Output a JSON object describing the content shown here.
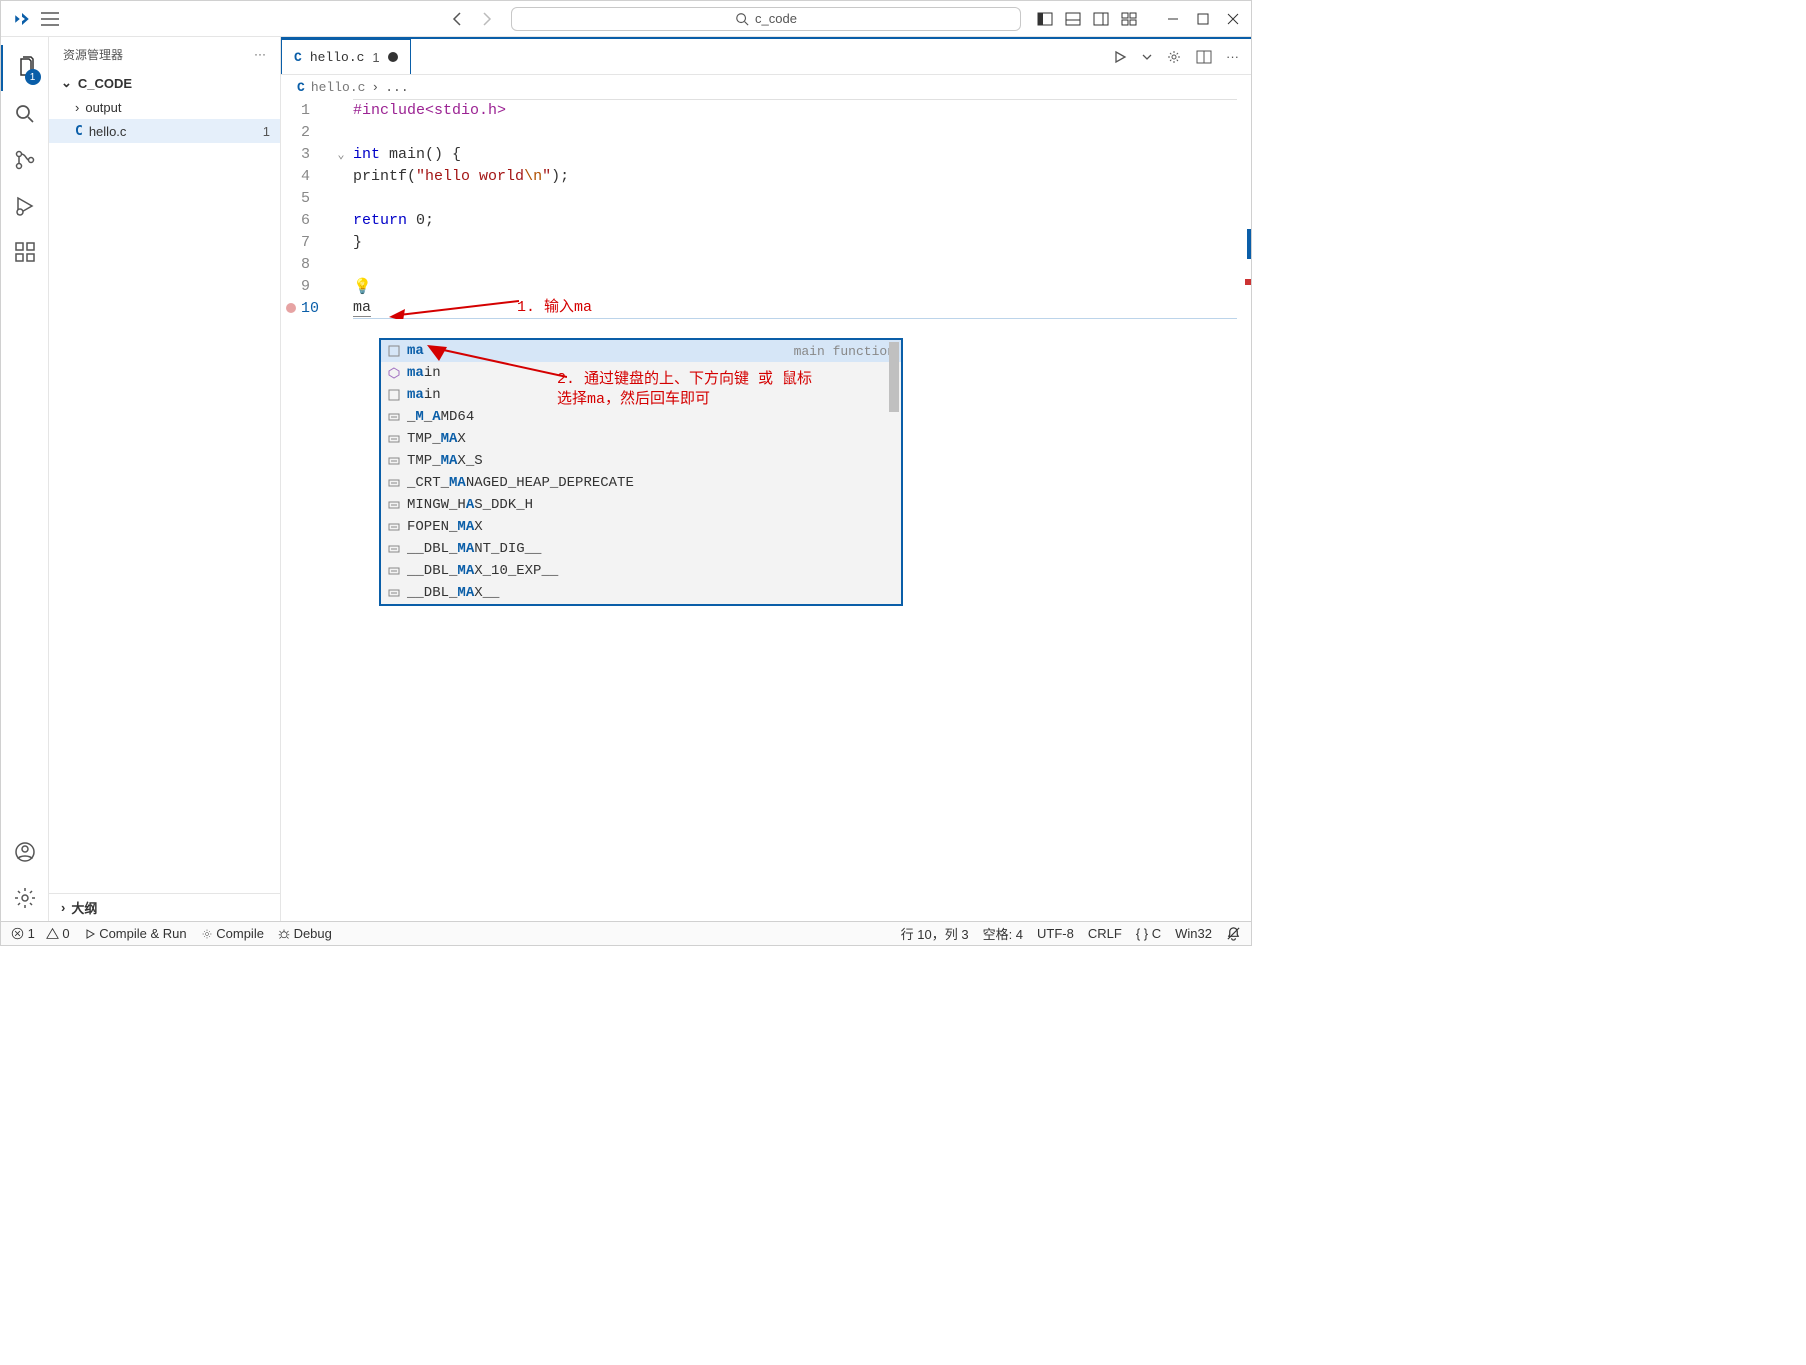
{
  "title_bar": {
    "search_text": "c_code"
  },
  "activity_bar": {
    "explorer_badge": "1"
  },
  "sidebar": {
    "title": "资源管理器",
    "project": "C_CODE",
    "items": [
      {
        "label": "output",
        "type": "folder"
      },
      {
        "label": "hello.c",
        "type": "c",
        "count": "1"
      }
    ],
    "outline_label": "大纲"
  },
  "tabs": {
    "active": {
      "label": "hello.c",
      "count": "1"
    }
  },
  "breadcrumb": {
    "file": "hello.c",
    "rest": "..."
  },
  "editor": {
    "lines": [
      "1",
      "2",
      "3",
      "4",
      "5",
      "6",
      "7",
      "8",
      "9",
      "10"
    ],
    "code": {
      "l1_pre1": "#include",
      "l1_pre2": "<stdio.h>",
      "l3_kw": "int",
      "l3_rest": " main() {",
      "l4_call": "printf",
      "l4_open": "(",
      "l4_str1": "\"hello world",
      "l4_esc": "\\n",
      "l4_str2": "\"",
      "l4_close": ");",
      "l6_kw": "return",
      "l6_rest": " 0;",
      "l7": "}",
      "l10_typed": "ma"
    }
  },
  "suggest": {
    "detail": "main function",
    "items": [
      {
        "icon": "snippet",
        "parts": [
          "ma"
        ],
        "rest": ""
      },
      {
        "icon": "method",
        "parts": [
          "ma"
        ],
        "rest": "in"
      },
      {
        "icon": "snippet",
        "parts": [
          "ma"
        ],
        "rest": "in"
      },
      {
        "icon": "const",
        "pre": "_",
        "parts": [
          "M",
          "A"
        ],
        "mid": "_",
        "rest": "MD64"
      },
      {
        "icon": "const",
        "pre": "TMP_",
        "parts": [
          "MA"
        ],
        "rest": "X"
      },
      {
        "icon": "const",
        "pre": "TMP_",
        "parts": [
          "MA"
        ],
        "rest": "X_S"
      },
      {
        "icon": "const",
        "pre": "_CRT_",
        "parts": [
          "MA"
        ],
        "rest": "NAGED_HEAP_DEPRECATE"
      },
      {
        "icon": "const",
        "pre": "MINGW_H",
        "parts": [
          "A"
        ],
        "rest": "S_DDK_H"
      },
      {
        "icon": "const",
        "pre": "FOPEN_",
        "parts": [
          "MA"
        ],
        "rest": "X"
      },
      {
        "icon": "const",
        "pre": "__DBL_",
        "parts": [
          "MA"
        ],
        "rest": "NT_DIG__"
      },
      {
        "icon": "const",
        "pre": "__DBL_",
        "parts": [
          "MA"
        ],
        "rest": "X_10_EXP__"
      },
      {
        "icon": "const",
        "pre": "__DBL_",
        "parts": [
          "MA"
        ],
        "rest": "X__"
      }
    ]
  },
  "annotations": {
    "a1": "1. 输入ma",
    "a2_l1": "2. 通过键盘的上、下方向键  或 鼠标",
    "a2_l2": "   选择ma，然后回车即可"
  },
  "status": {
    "errors": "1",
    "warnings": "0",
    "compile_run": "Compile & Run",
    "compile": "Compile",
    "debug": "Debug",
    "pos": "行 10，列 3",
    "spaces": "空格: 4",
    "encoding": "UTF-8",
    "eol": "CRLF",
    "lang_braces": "{ }",
    "lang": "C",
    "target": "Win32"
  }
}
